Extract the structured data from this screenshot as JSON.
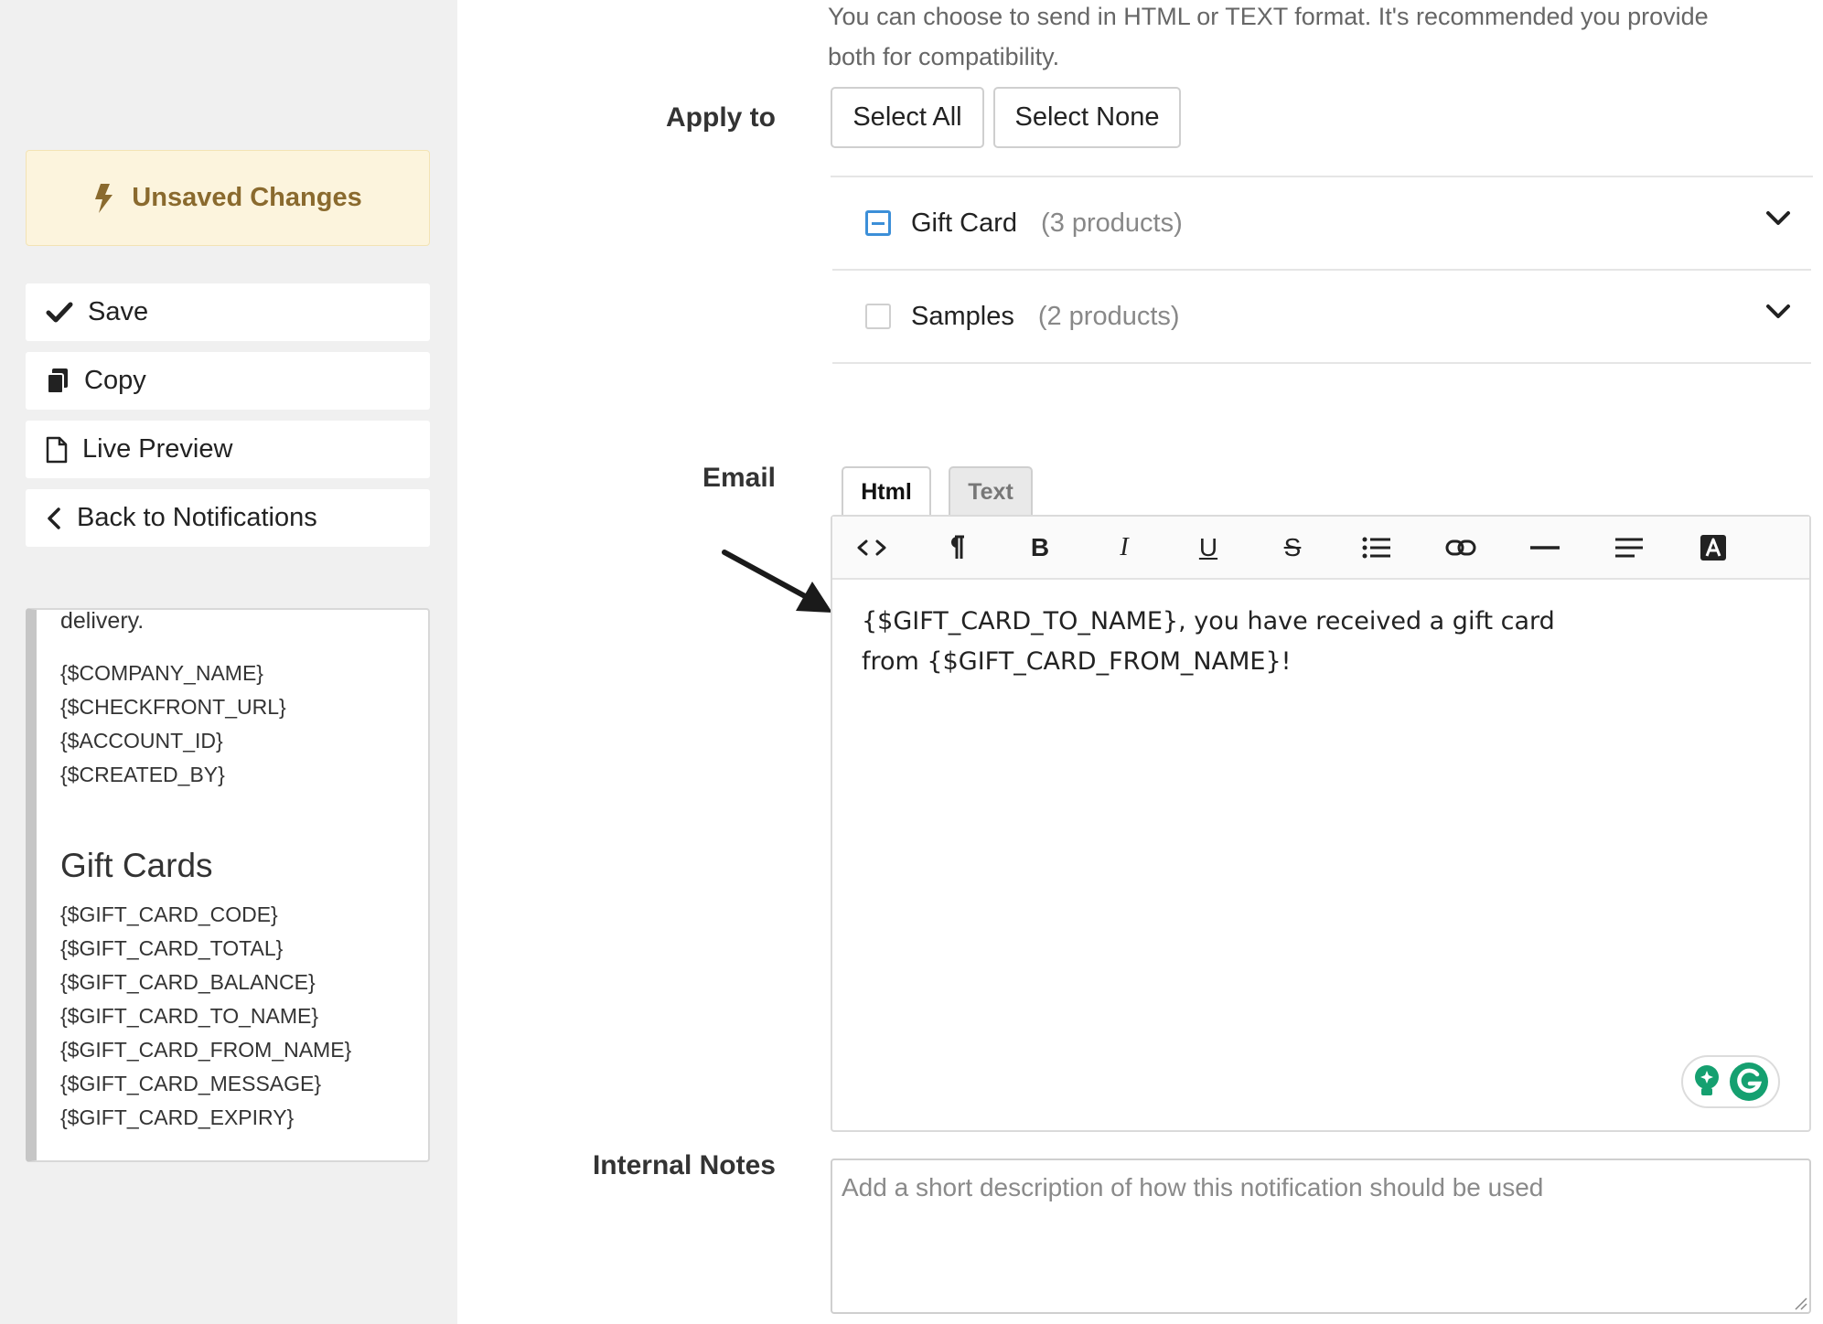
{
  "sidebar": {
    "unsaved_label": "Unsaved Changes",
    "buttons": [
      {
        "label": "Save",
        "icon": "check-icon"
      },
      {
        "label": "Copy",
        "icon": "copy-icon"
      },
      {
        "label": "Live Preview",
        "icon": "document-icon"
      },
      {
        "label": "Back to Notifications",
        "icon": "chevron-left-icon"
      }
    ],
    "variables": {
      "fragment": "delivery.",
      "general": [
        "{$COMPANY_NAME}",
        "{$CHECKFRONT_URL}",
        "{$ACCOUNT_ID}",
        "{$CREATED_BY}"
      ],
      "gift_cards_title": "Gift Cards",
      "gift_cards": [
        "{$GIFT_CARD_CODE}",
        "{$GIFT_CARD_TOTAL}",
        "{$GIFT_CARD_BALANCE}",
        "{$GIFT_CARD_TO_NAME}",
        "{$GIFT_CARD_FROM_NAME}",
        "{$GIFT_CARD_MESSAGE}",
        "{$GIFT_CARD_EXPIRY}"
      ]
    }
  },
  "main": {
    "intro_line1": "You can choose to send in HTML or TEXT format. It's recommended you provide",
    "intro_line2": "both for compatibility.",
    "apply_to": {
      "label": "Apply to",
      "select_all": "Select All",
      "select_none": "Select None",
      "categories": [
        {
          "name": "Gift Card",
          "count": "(3 products)",
          "state": "partial"
        },
        {
          "name": "Samples",
          "count": "(2 products)",
          "state": "unchecked"
        }
      ]
    },
    "email": {
      "label": "Email",
      "tabs": [
        "Html",
        "Text"
      ],
      "active_tab": "Html",
      "toolbar": [
        "code-view-icon",
        "paragraph-icon",
        "bold-icon",
        "italic-icon",
        "underline-icon",
        "strikethrough-icon",
        "list-icon",
        "link-icon",
        "horizontal-rule-icon",
        "align-icon",
        "font-color-icon"
      ],
      "content_line1": "{$GIFT_CARD_TO_NAME}, you have received a gift card",
      "content_line2": "from {$GIFT_CARD_FROM_NAME}!"
    },
    "internal_notes": {
      "label": "Internal Notes",
      "placeholder": "Add a short description of how this notification should be used"
    }
  },
  "colors": {
    "unsaved_bg": "#fcf4dd",
    "unsaved_text": "#8a6a2e",
    "checkbox_accent": "#3c8fd8",
    "grammarly_green": "#15a070"
  }
}
